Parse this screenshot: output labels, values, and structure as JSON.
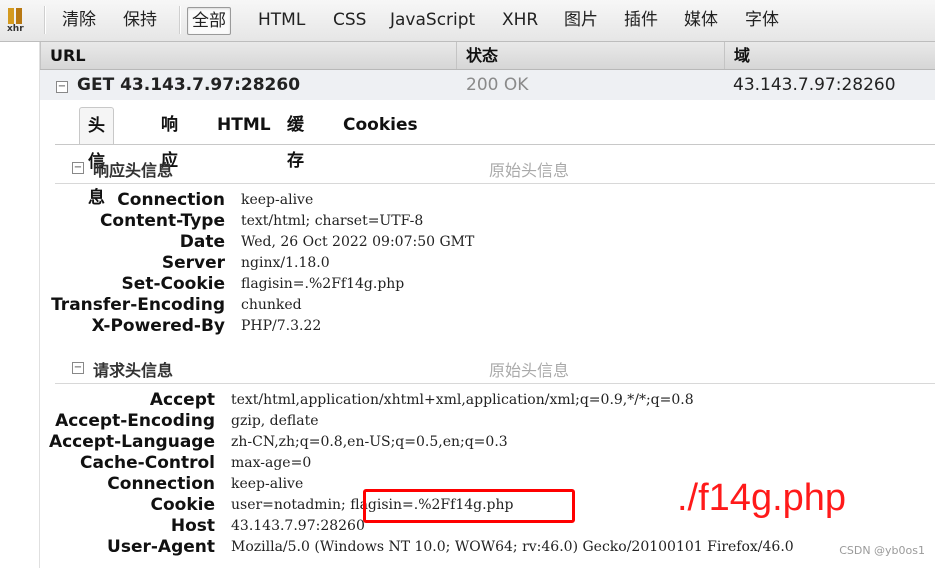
{
  "toolbar": {
    "icon_label": "xhr",
    "items": [
      "清除",
      "保持",
      "全部",
      "HTML",
      "CSS",
      "JavaScript",
      "XHR",
      "图片",
      "插件",
      "媒体",
      "字体"
    ],
    "active": "全部"
  },
  "columns": {
    "url": "URL",
    "status": "状态",
    "domain": "域"
  },
  "request": {
    "method_url": "GET 43.143.7.97:28260",
    "status": "200 OK",
    "domain": "43.143.7.97:28260"
  },
  "detail_tabs": [
    "头信息",
    "响应",
    "HTML",
    "缓存",
    "Cookies"
  ],
  "response_section": {
    "title": "响应头信息",
    "raw_link": "原始头信息",
    "headers": [
      {
        "name": "Connection",
        "value": "keep-alive"
      },
      {
        "name": "Content-Type",
        "value": "text/html; charset=UTF-8"
      },
      {
        "name": "Date",
        "value": "Wed, 26 Oct 2022 09:07:50 GMT"
      },
      {
        "name": "Server",
        "value": "nginx/1.18.0"
      },
      {
        "name": "Set-Cookie",
        "value": "flagisin=.%2Ff14g.php"
      },
      {
        "name": "Transfer-Encoding",
        "value": "chunked"
      },
      {
        "name": "X-Powered-By",
        "value": "PHP/7.3.22"
      }
    ]
  },
  "request_section": {
    "title": "请求头信息",
    "raw_link": "原始头信息",
    "headers": [
      {
        "name": "Accept",
        "value": "text/html,application/xhtml+xml,application/xml;q=0.9,*/*;q=0.8"
      },
      {
        "name": "Accept-Encoding",
        "value": "gzip, deflate"
      },
      {
        "name": "Accept-Language",
        "value": "zh-CN,zh;q=0.8,en-US;q=0.5,en;q=0.3"
      },
      {
        "name": "Cache-Control",
        "value": "max-age=0"
      },
      {
        "name": "Connection",
        "value": "keep-alive"
      },
      {
        "name": "Cookie",
        "value": "user=notadmin; flagisin=.%2Ff14g.php"
      },
      {
        "name": "Host",
        "value": "43.143.7.97:28260"
      },
      {
        "name": "User-Agent",
        "value": "Mozilla/5.0 (Windows NT 10.0; WOW64; rv:46.0) Gecko/20100101 Firefox/46.0"
      }
    ]
  },
  "annotation": "./f14g.php",
  "watermark": "CSDN @yb0os1",
  "colors": {
    "annotation": "#ff1a1a",
    "status_text": "#8a8a8a"
  }
}
